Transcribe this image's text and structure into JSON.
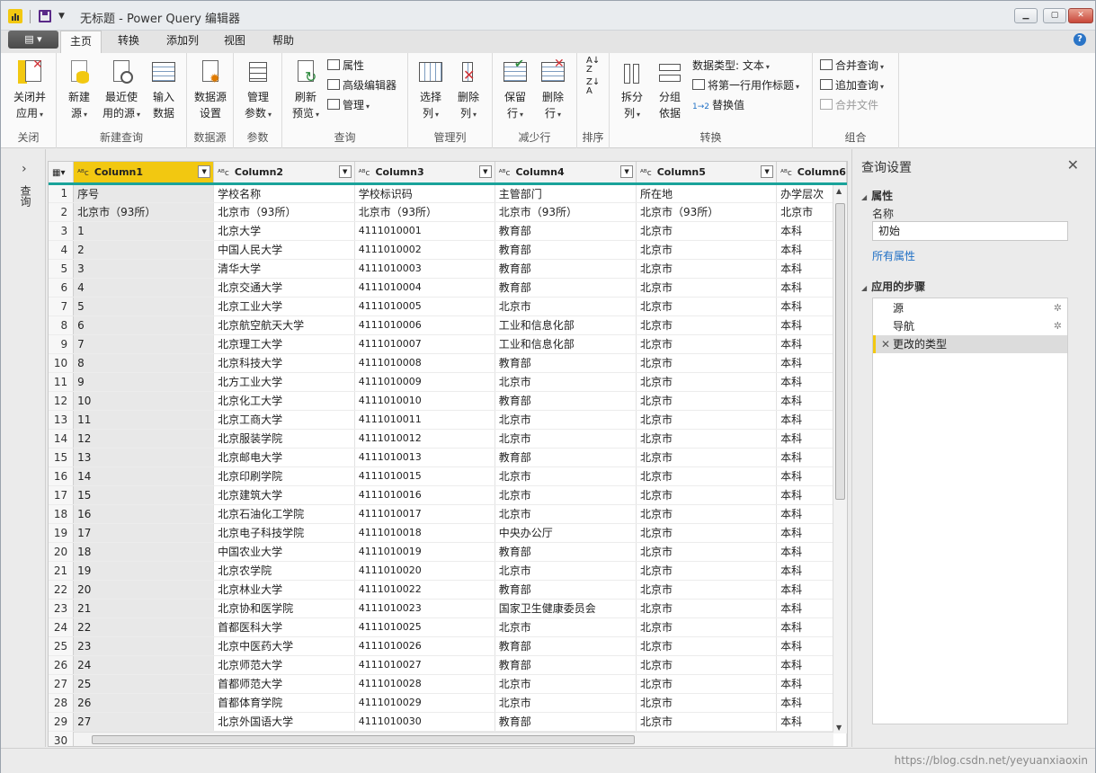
{
  "window": {
    "title": "无标题 - Power Query 编辑器"
  },
  "tabs": {
    "file_label": "▤ ▾",
    "items": [
      "主页",
      "转换",
      "添加列",
      "视图",
      "帮助"
    ]
  },
  "ribbon": {
    "close": {
      "btn": [
        "关闭并",
        "应用"
      ],
      "group": "关闭"
    },
    "newquery": {
      "new_source": [
        "新建",
        "源"
      ],
      "recent": [
        "最近使",
        "用的源"
      ],
      "enter": [
        "输入",
        "数据"
      ],
      "group": "新建查询"
    },
    "datasource": {
      "settings": [
        "数据源",
        "设置"
      ],
      "group": "数据源"
    },
    "params": {
      "manage": [
        "管理",
        "参数"
      ],
      "group": "参数"
    },
    "query": {
      "refresh": [
        "刷新",
        "预览"
      ],
      "props": "属性",
      "advanced": "高级编辑器",
      "manage": "管理",
      "group": "查询"
    },
    "columns": {
      "choose": [
        "选择",
        "列"
      ],
      "remove": [
        "删除",
        "列"
      ],
      "group": "管理列"
    },
    "rows": {
      "keep": [
        "保留",
        "行"
      ],
      "remove": [
        "删除",
        "行"
      ],
      "group": "减少行"
    },
    "sort": {
      "group": "排序"
    },
    "transform": {
      "split": [
        "拆分",
        "列"
      ],
      "groupby": [
        "分组",
        "依据"
      ],
      "datatype": "数据类型: 文本",
      "firstrow": "将第一行用作标题",
      "replace": "替换值",
      "group": "转换"
    },
    "combine": {
      "merge": "合并查询",
      "append": "追加查询",
      "files": "合并文件",
      "group": "组合"
    }
  },
  "nav": {
    "label": "查询"
  },
  "grid": {
    "columns": [
      "Column1",
      "Column2",
      "Column3",
      "Column4",
      "Column5",
      "Column6"
    ],
    "rows": [
      [
        "序号",
        "学校名称",
        "学校标识码",
        "主管部门",
        "所在地",
        "办学层次"
      ],
      [
        "北京市（93所）",
        "北京市（93所）",
        "北京市（93所）",
        "北京市（93所）",
        "北京市（93所）",
        "北京市"
      ],
      [
        "1",
        "北京大学",
        "4111010001",
        "教育部",
        "北京市",
        "本科"
      ],
      [
        "2",
        "中国人民大学",
        "4111010002",
        "教育部",
        "北京市",
        "本科"
      ],
      [
        "3",
        "清华大学",
        "4111010003",
        "教育部",
        "北京市",
        "本科"
      ],
      [
        "4",
        "北京交通大学",
        "4111010004",
        "教育部",
        "北京市",
        "本科"
      ],
      [
        "5",
        "北京工业大学",
        "4111010005",
        "北京市",
        "北京市",
        "本科"
      ],
      [
        "6",
        "北京航空航天大学",
        "4111010006",
        "工业和信息化部",
        "北京市",
        "本科"
      ],
      [
        "7",
        "北京理工大学",
        "4111010007",
        "工业和信息化部",
        "北京市",
        "本科"
      ],
      [
        "8",
        "北京科技大学",
        "4111010008",
        "教育部",
        "北京市",
        "本科"
      ],
      [
        "9",
        "北方工业大学",
        "4111010009",
        "北京市",
        "北京市",
        "本科"
      ],
      [
        "10",
        "北京化工大学",
        "4111010010",
        "教育部",
        "北京市",
        "本科"
      ],
      [
        "11",
        "北京工商大学",
        "4111010011",
        "北京市",
        "北京市",
        "本科"
      ],
      [
        "12",
        "北京服装学院",
        "4111010012",
        "北京市",
        "北京市",
        "本科"
      ],
      [
        "13",
        "北京邮电大学",
        "4111010013",
        "教育部",
        "北京市",
        "本科"
      ],
      [
        "14",
        "北京印刷学院",
        "4111010015",
        "北京市",
        "北京市",
        "本科"
      ],
      [
        "15",
        "北京建筑大学",
        "4111010016",
        "北京市",
        "北京市",
        "本科"
      ],
      [
        "16",
        "北京石油化工学院",
        "4111010017",
        "北京市",
        "北京市",
        "本科"
      ],
      [
        "17",
        "北京电子科技学院",
        "4111010018",
        "中央办公厅",
        "北京市",
        "本科"
      ],
      [
        "18",
        "中国农业大学",
        "4111010019",
        "教育部",
        "北京市",
        "本科"
      ],
      [
        "19",
        "北京农学院",
        "4111010020",
        "北京市",
        "北京市",
        "本科"
      ],
      [
        "20",
        "北京林业大学",
        "4111010022",
        "教育部",
        "北京市",
        "本科"
      ],
      [
        "21",
        "北京协和医学院",
        "4111010023",
        "国家卫生健康委员会",
        "北京市",
        "本科"
      ],
      [
        "22",
        "首都医科大学",
        "4111010025",
        "北京市",
        "北京市",
        "本科"
      ],
      [
        "23",
        "北京中医药大学",
        "4111010026",
        "教育部",
        "北京市",
        "本科"
      ],
      [
        "24",
        "北京师范大学",
        "4111010027",
        "教育部",
        "北京市",
        "本科"
      ],
      [
        "25",
        "首都师范大学",
        "4111010028",
        "北京市",
        "北京市",
        "本科"
      ],
      [
        "26",
        "首都体育学院",
        "4111010029",
        "北京市",
        "北京市",
        "本科"
      ],
      [
        "27",
        "北京外国语大学",
        "4111010030",
        "教育部",
        "北京市",
        "本科"
      ],
      [
        "",
        "",
        "",
        "",
        "",
        ""
      ]
    ]
  },
  "settings": {
    "title": "查询设置",
    "props_header": "属性",
    "name_label": "名称",
    "name_value": "初始",
    "all_props": "所有属性",
    "steps_header": "应用的步骤",
    "steps": [
      "源",
      "导航",
      "更改的类型"
    ]
  },
  "status": {
    "watermark": "https://blog.csdn.net/yeyuanxiaoxin"
  }
}
